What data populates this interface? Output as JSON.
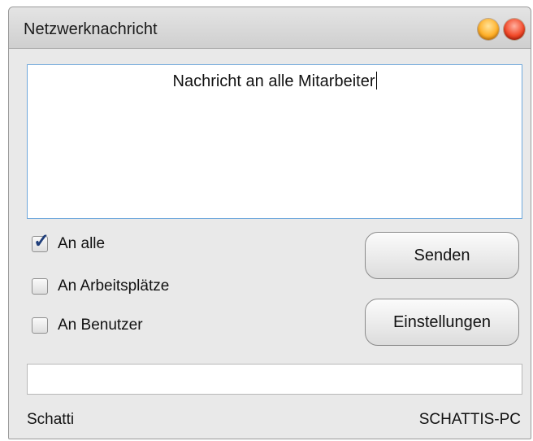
{
  "window": {
    "title": "Netzwerknachricht"
  },
  "message": {
    "text": "Nachricht an alle Mitarbeiter"
  },
  "options": [
    {
      "label": "An alle",
      "checked": true
    },
    {
      "label": "An Arbeitsplätze",
      "checked": false
    },
    {
      "label": "An Benutzer",
      "checked": false
    }
  ],
  "buttons": {
    "send": "Senden",
    "settings": "Einstellungen"
  },
  "status": {
    "value": ""
  },
  "footer": {
    "user": "Schatti",
    "computer": "SCHATTIS-PC"
  },
  "colors": {
    "accent_border": "#6fa8dc",
    "minimize": "#ffb12a",
    "close": "#f24a2a",
    "check_mark": "#1f3e7a"
  },
  "icons": {
    "minimize": "orange-circle",
    "close": "red-circle",
    "check": "check-mark"
  }
}
